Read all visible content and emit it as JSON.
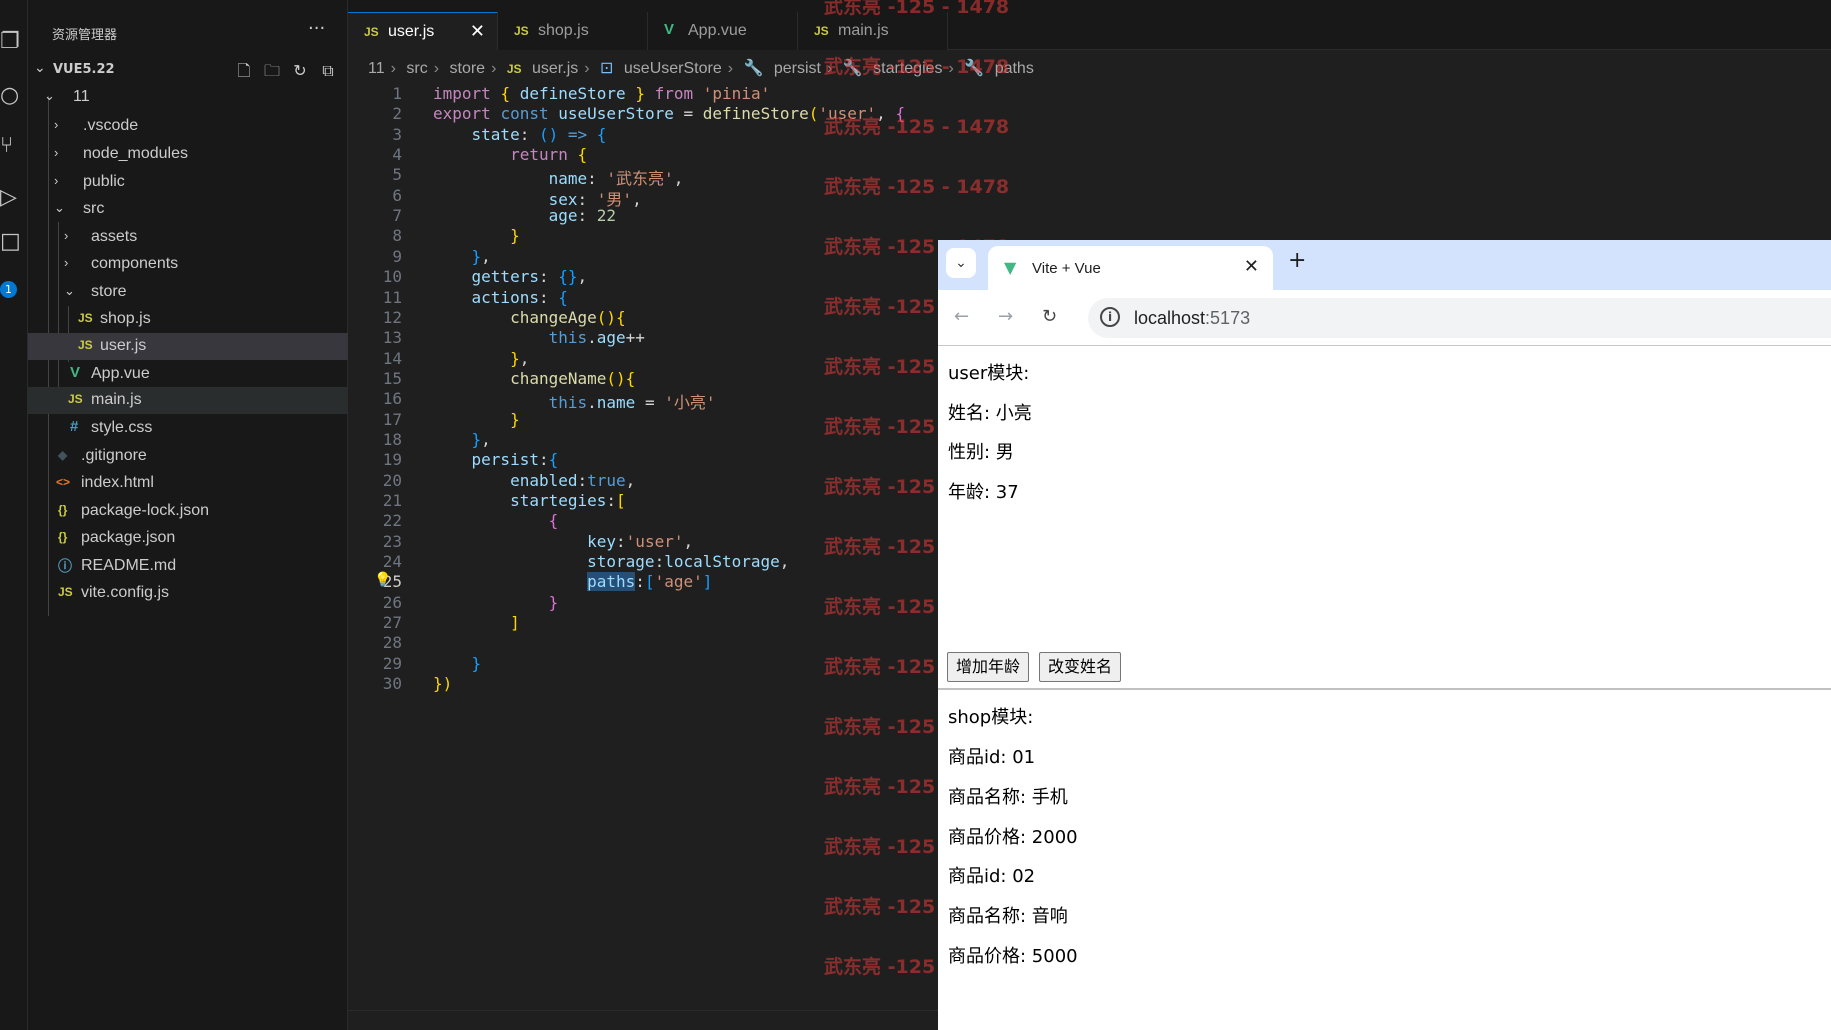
{
  "sidebar": {
    "title": "资源管理器",
    "root": "VUE5.22",
    "tree": [
      {
        "name": "11"
      },
      {
        "name": ".vscode"
      },
      {
        "name": "node_modules"
      },
      {
        "name": "public"
      },
      {
        "name": "src"
      },
      {
        "name": "assets"
      },
      {
        "name": "components"
      },
      {
        "name": "store"
      },
      {
        "name": "shop.js",
        "icon": "JS"
      },
      {
        "name": "user.js",
        "icon": "JS"
      },
      {
        "name": "App.vue",
        "icon": "V"
      },
      {
        "name": "main.js",
        "icon": "JS"
      },
      {
        "name": "style.css",
        "icon": "#"
      },
      {
        "name": ".gitignore",
        "icon": "◆"
      },
      {
        "name": "index.html",
        "icon": "<>"
      },
      {
        "name": "package-lock.json",
        "icon": "{}"
      },
      {
        "name": "package.json",
        "icon": "{}"
      },
      {
        "name": "README.md",
        "icon": "ⓘ"
      },
      {
        "name": "vite.config.js",
        "icon": "JS"
      }
    ],
    "badge": "1"
  },
  "tabs": [
    {
      "label": "user.js",
      "icon": "JS"
    },
    {
      "label": "shop.js",
      "icon": "JS"
    },
    {
      "label": "App.vue",
      "icon": "V"
    },
    {
      "label": "main.js",
      "icon": "JS"
    }
  ],
  "breadcrumb": [
    "11",
    "src",
    "store",
    "user.js",
    "useUserStore",
    "persist",
    "startegies",
    "paths"
  ],
  "code": {
    "line_numbers": [
      "1",
      "2",
      "3",
      "4",
      "5",
      "6",
      "7",
      "8",
      "9",
      "10",
      "11",
      "12",
      "13",
      "14",
      "15",
      "16",
      "17",
      "18",
      "19",
      "20",
      "21",
      "22",
      "23",
      "24",
      "25",
      "26",
      "27",
      "28",
      "29",
      "30"
    ],
    "active_line": "25"
  },
  "watermark": "武东亮 -125 - 1478",
  "browser": {
    "tab_title": "Vite + Vue",
    "url_host": "localhost",
    "url_port": ":5173",
    "page": {
      "user_heading": "user模块:",
      "name_line": "姓名: 小亮",
      "sex_line": "性别: 男",
      "age_line": "年龄: 37",
      "btn_age": "增加年龄",
      "btn_name": "改变姓名",
      "shop_heading": "shop模块:",
      "item1_id": "商品id: 01",
      "item1_name": "商品名称: 手机",
      "item1_price": "商品价格: 2000",
      "item2_id": "商品id: 02",
      "item2_name": "商品名称: 音响",
      "item2_price": "商品价格: 5000"
    }
  },
  "colors": {
    "editor_bg": "#1f1f1f",
    "sidebar_bg": "#181818",
    "accent": "#0078d4",
    "watermark": "#e03a3a",
    "browser_tabstrip": "#d3e3fd"
  }
}
